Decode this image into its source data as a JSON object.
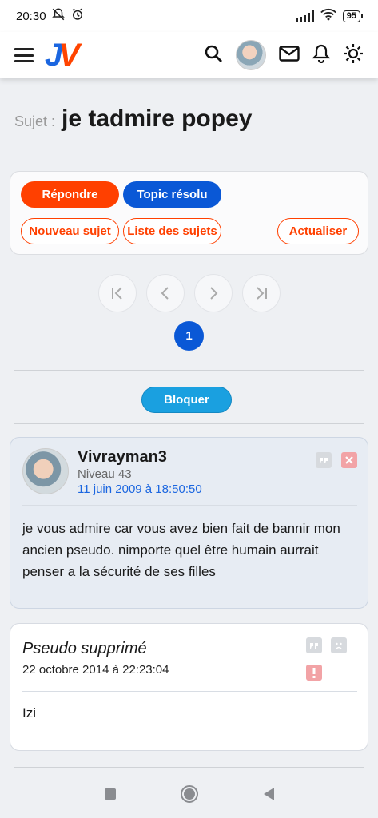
{
  "status": {
    "time": "20:30",
    "battery": "95"
  },
  "topic": {
    "label": "Sujet :",
    "title": "je tadmire popey"
  },
  "buttons": {
    "reply": "Répondre",
    "resolved": "Topic résolu",
    "new_topic": "Nouveau sujet",
    "topic_list": "Liste des sujets",
    "refresh": "Actualiser",
    "block": "Bloquer"
  },
  "pagination": {
    "current": "1"
  },
  "posts": [
    {
      "author": "Vivrayman3",
      "level": "Niveau 43",
      "date": "11 juin 2009 à 18:50:50",
      "message": "je vous admire car vous avez bien fait de bannir mon ancien pseudo. nimporte quel être humain aurrait penser a la sécurité de ses filles"
    },
    {
      "author": "Pseudo supprimé",
      "date": "22 octobre 2014 à 22:23:04",
      "message": "Izi"
    }
  ],
  "colors": {
    "brand_orange": "#ff4000",
    "brand_blue": "#0a58d6",
    "block_blue": "#1aa0e0"
  }
}
